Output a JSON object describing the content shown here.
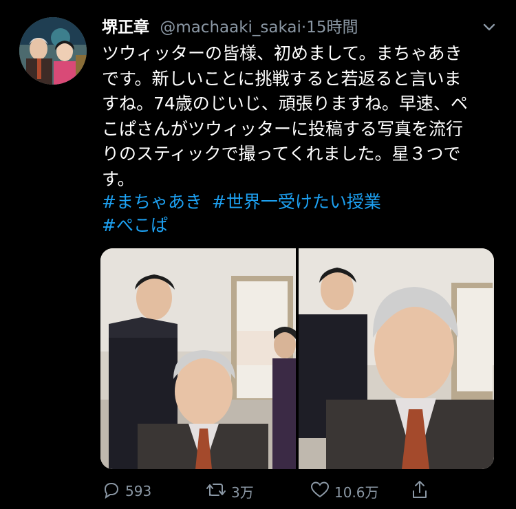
{
  "tweet": {
    "display_name": "堺正章",
    "handle": "@machaaki_sakai",
    "separator": "·",
    "time": "15時間",
    "text": "ツウィッターの皆様、初めまして。まちゃあき\nです。新しいことに挑戦すると若返ると言いま\nすね。74歳のじいじ、頑張りますね。早速、ペ\nこぱさんがツウィッターに投稿する写真を流行\nりのスティックで撮ってくれました。星３つで\nす。",
    "hashtags": [
      "#まちゃあき",
      "#世界一受けたい授業",
      "#ぺこぱ"
    ]
  },
  "actions": {
    "reply_count": "593",
    "retweet_count": "3万",
    "like_count": "10.6万"
  },
  "icons": {
    "reply": "reply-icon",
    "retweet": "retweet-icon",
    "like": "heart-icon",
    "share": "share-icon",
    "more": "chevron-down-icon"
  },
  "colors": {
    "background": "#000000",
    "secondary_text": "#8b98a5",
    "link": "#1da1f2"
  }
}
